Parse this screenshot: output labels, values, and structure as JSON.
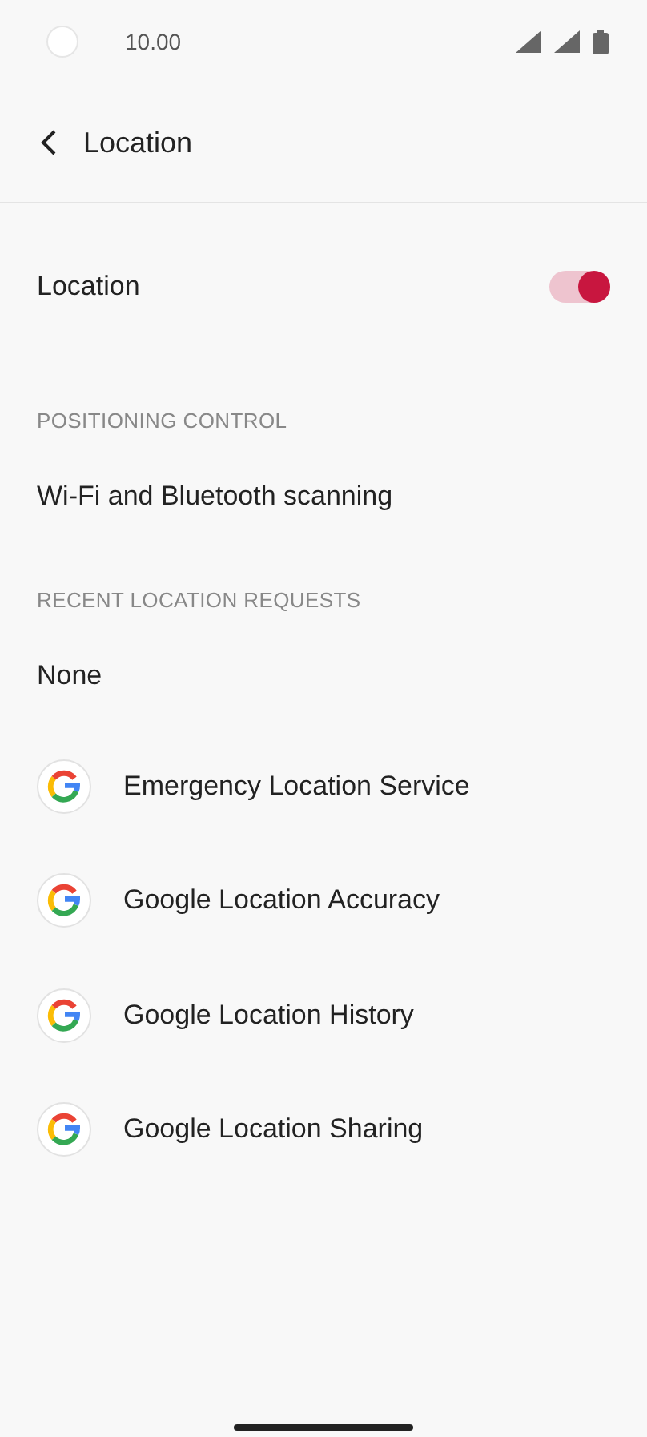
{
  "status_bar": {
    "time": "10.00"
  },
  "header": {
    "title": "Location"
  },
  "main_toggle": {
    "label": "Location",
    "on": true
  },
  "sections": [
    {
      "title": "POSITIONING CONTROL",
      "items": [
        {
          "kind": "text",
          "label": "Wi-Fi and Bluetooth scanning"
        }
      ]
    },
    {
      "title": "RECENT LOCATION REQUESTS",
      "items": [
        {
          "kind": "text",
          "label": "None"
        },
        {
          "kind": "app",
          "label": "Emergency Location Service"
        },
        {
          "kind": "app",
          "label": "Google Location Accuracy"
        },
        {
          "kind": "app",
          "label": "Google Location History"
        },
        {
          "kind": "app",
          "label": "Google Location Sharing"
        }
      ]
    }
  ]
}
